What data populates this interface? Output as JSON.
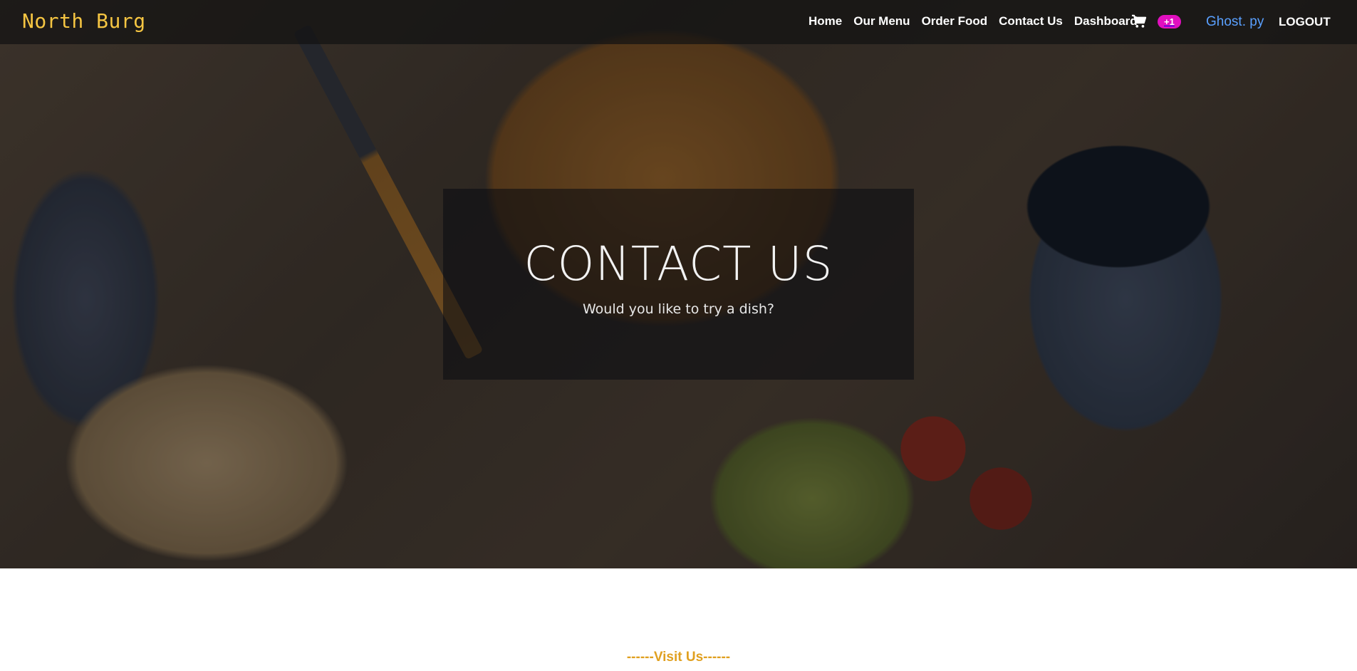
{
  "navbar": {
    "brand": "North Burg",
    "links": [
      {
        "label": "Home"
      },
      {
        "label": "Our Menu"
      },
      {
        "label": "Order Food"
      },
      {
        "label": "Contact Us"
      },
      {
        "label": "Dashboard"
      }
    ],
    "cart": {
      "icon": "cart-icon",
      "badge": "+1"
    },
    "user": "Ghost. py",
    "logout": "LOGOUT"
  },
  "hero": {
    "title": "CONTACT US",
    "subtitle": "Would you like to try a dish?"
  },
  "section": {
    "visit_heading": "------Visit Us------"
  },
  "colors": {
    "brand": "#f5c542",
    "badge": "#e10fbf",
    "user_link": "#5aa0ff",
    "accent_heading": "#e0a020"
  }
}
